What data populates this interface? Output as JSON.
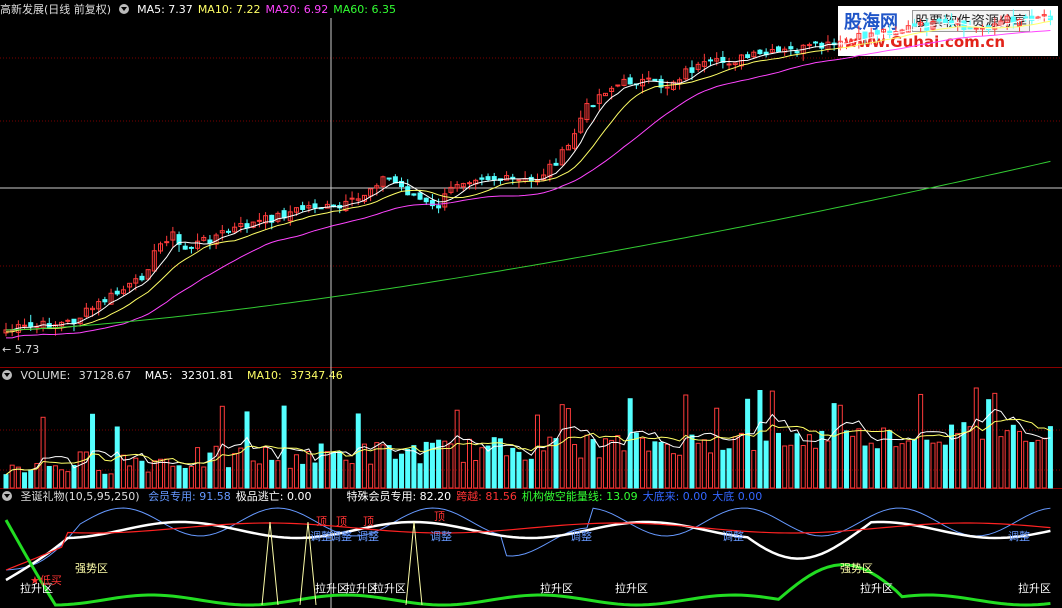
{
  "main": {
    "title": "高新发展(日线 前复权)",
    "ma": [
      {
        "label": "MA5:",
        "value": "7.37",
        "color": "#ffffff"
      },
      {
        "label": "MA10:",
        "value": "7.22",
        "color": "#ffff66"
      },
      {
        "label": "MA20:",
        "value": "6.92",
        "color": "#ff44ff"
      },
      {
        "label": "MA60:",
        "value": "6.35",
        "color": "#33ff33"
      }
    ],
    "low_price": "5.73"
  },
  "volume": {
    "title": "VOLUME:",
    "value": "37128.67",
    "ma5_label": "MA5:",
    "ma5": "32301.81",
    "ma10_label": "MA10:",
    "ma10": "37347.46"
  },
  "indicator": {
    "title": "圣诞礼物(10,5,95,250)",
    "items": [
      {
        "label": "会员专用:",
        "value": "91.58",
        "color": "#6699ff"
      },
      {
        "label": "极品逃亡:",
        "value": "0.00",
        "color": "#ffffff"
      },
      {
        "label": "特殊会员专用:",
        "value": "82.20",
        "color": "#ffffff"
      },
      {
        "label": "跨越:",
        "value": "81.56",
        "color": "#ff3333"
      },
      {
        "label": "机构做空能量线:",
        "value": "13.09",
        "color": "#33ff33"
      },
      {
        "label": "大底来:",
        "value": "0.00",
        "color": "#3366ff"
      },
      {
        "label": "大底",
        "value": "0.00",
        "color": "#3366ff"
      }
    ],
    "signals": {
      "lsq": "拉升区",
      "qsq": "强势区",
      "dimai": "★低买",
      "tiaozheng": "调整",
      "ding": "顶"
    }
  },
  "logo": {
    "cn": "股海网",
    "sub": "股票软件资源分享",
    "url": "www.Guhai.com.cn"
  },
  "colors": {
    "up": "#ff3b3b",
    "down": "#54ffff",
    "separator": "#8b0000"
  }
}
